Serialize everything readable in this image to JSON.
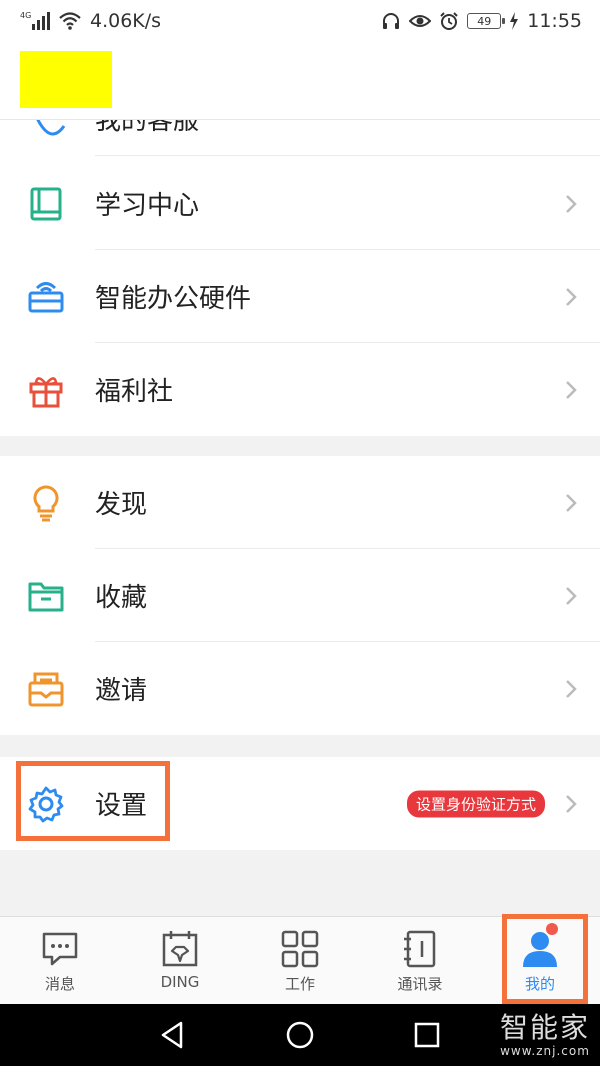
{
  "status_bar": {
    "network_type": "4G",
    "speed": "4.06K/s",
    "battery": "49",
    "time": "11:55"
  },
  "cutoff_item": {
    "label": "我的客服"
  },
  "groups": [
    {
      "items": [
        {
          "name": "study-center",
          "label": "学习中心",
          "icon": "book-icon",
          "color": "#26b18a"
        },
        {
          "name": "smart-office-hardware",
          "label": "智能办公硬件",
          "icon": "wifi-device-icon",
          "color": "#2e8cf0"
        },
        {
          "name": "welfare",
          "label": "福利社",
          "icon": "gift-icon",
          "color": "#e8503b"
        }
      ]
    },
    {
      "items": [
        {
          "name": "discover",
          "label": "发现",
          "icon": "lightbulb-icon",
          "color": "#f0952e"
        },
        {
          "name": "favorites",
          "label": "收藏",
          "icon": "folder-icon",
          "color": "#26b18a"
        },
        {
          "name": "invite",
          "label": "邀请",
          "icon": "envelope-icon",
          "color": "#f0952e"
        }
      ]
    },
    {
      "items": [
        {
          "name": "settings",
          "label": "设置",
          "icon": "gear-icon",
          "color": "#2e8cf0",
          "badge": "设置身份验证方式"
        }
      ]
    }
  ],
  "tabs": [
    {
      "label": "消息",
      "icon": "chat-icon",
      "active": false
    },
    {
      "label": "DING",
      "icon": "ding-icon",
      "active": false
    },
    {
      "label": "工作",
      "icon": "grid-icon",
      "active": false
    },
    {
      "label": "通讯录",
      "icon": "contacts-icon",
      "active": false
    },
    {
      "label": "我的",
      "icon": "person-icon",
      "active": true
    }
  ],
  "watermark": {
    "main": "智能家",
    "sub": "www.znj.com"
  },
  "colors": {
    "accent": "#2e8cf0",
    "highlight": "#f4713c",
    "badge": "#e8383d"
  }
}
